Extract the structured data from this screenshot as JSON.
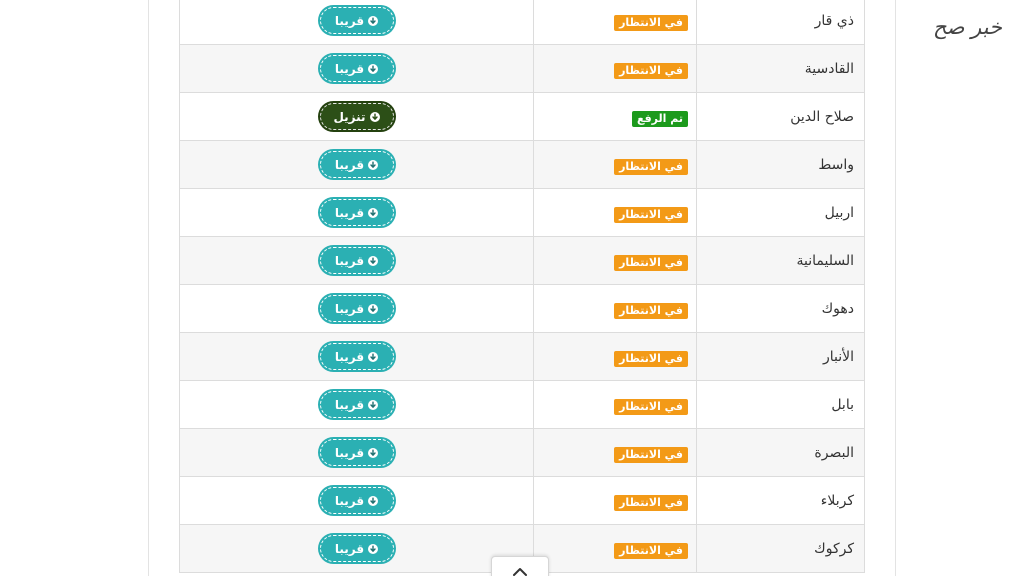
{
  "watermark": "خبر صح",
  "colors": {
    "pending": "#f39a17",
    "uploaded": "#1c9a1c",
    "soon_button": "#2bb0b3",
    "download_button": "#2c4f17"
  },
  "rows": [
    {
      "governorate": "ذي قار",
      "status": "في الانتظار",
      "status_type": "pending",
      "action": "قريبا",
      "action_type": "soon"
    },
    {
      "governorate": "القادسية",
      "status": "في الانتظار",
      "status_type": "pending",
      "action": "قريبا",
      "action_type": "soon"
    },
    {
      "governorate": "صلاح الدين",
      "status": "تم الرفع",
      "status_type": "uploaded",
      "action": "تنزيل",
      "action_type": "download"
    },
    {
      "governorate": "واسط",
      "status": "في الانتظار",
      "status_type": "pending",
      "action": "قريبا",
      "action_type": "soon"
    },
    {
      "governorate": "اربيل",
      "status": "في الانتظار",
      "status_type": "pending",
      "action": "قريبا",
      "action_type": "soon"
    },
    {
      "governorate": "السليمانية",
      "status": "في الانتظار",
      "status_type": "pending",
      "action": "قريبا",
      "action_type": "soon"
    },
    {
      "governorate": "دهوك",
      "status": "في الانتظار",
      "status_type": "pending",
      "action": "قريبا",
      "action_type": "soon"
    },
    {
      "governorate": "الأنبار",
      "status": "في الانتظار",
      "status_type": "pending",
      "action": "قريبا",
      "action_type": "soon"
    },
    {
      "governorate": "بابل",
      "status": "في الانتظار",
      "status_type": "pending",
      "action": "قريبا",
      "action_type": "soon"
    },
    {
      "governorate": "البصرة",
      "status": "في الانتظار",
      "status_type": "pending",
      "action": "قريبا",
      "action_type": "soon"
    },
    {
      "governorate": "كربلاء",
      "status": "في الانتظار",
      "status_type": "pending",
      "action": "قريبا",
      "action_type": "soon"
    },
    {
      "governorate": "كركوك",
      "status": "في الانتظار",
      "status_type": "pending",
      "action": "قريبا",
      "action_type": "soon"
    }
  ],
  "icons": {
    "action": "arrow-down-circle-icon",
    "scroll_top": "chevron-up-icon"
  }
}
